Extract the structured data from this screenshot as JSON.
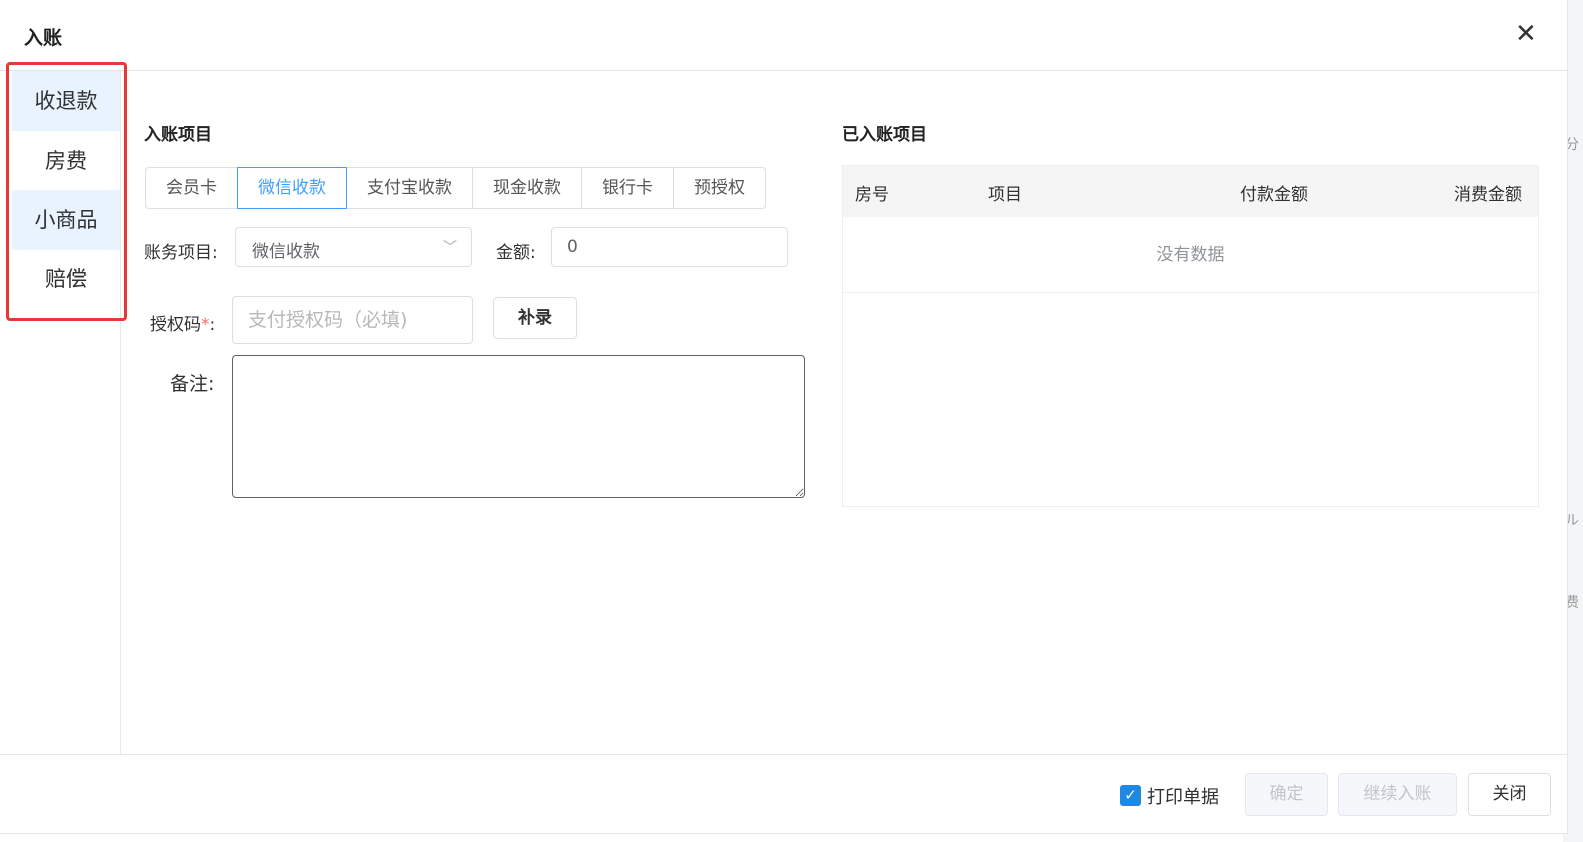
{
  "dialog": {
    "title": "入账",
    "close_icon": "close-icon"
  },
  "sidebar": {
    "items": [
      {
        "label": "收退款"
      },
      {
        "label": "房费"
      },
      {
        "label": "小商品"
      },
      {
        "label": "赔偿"
      }
    ]
  },
  "entry": {
    "section_title": "入账项目",
    "payment_tabs": [
      {
        "label": "会员卡",
        "active": false
      },
      {
        "label": "微信收款",
        "active": true
      },
      {
        "label": "支付宝收款",
        "active": false
      },
      {
        "label": "现金收款",
        "active": false
      },
      {
        "label": "银行卡",
        "active": false
      },
      {
        "label": "预授权",
        "active": false
      }
    ],
    "account_item_label": "账务项目:",
    "account_item_value": "微信收款",
    "amount_label": "金额:",
    "amount_value": "0",
    "auth_label": "授权码",
    "auth_required_mark": "*",
    "auth_colon": ":",
    "auth_placeholder": "支付授权码（必填)",
    "supplement_button": "补录",
    "remark_label": "备注:",
    "remark_value": ""
  },
  "posted": {
    "section_title": "已入账项目",
    "columns": [
      "房号",
      "项目",
      "付款金额",
      "消费金额"
    ],
    "empty_text": "没有数据"
  },
  "footer": {
    "print_receipt_label": "打印单据",
    "print_receipt_checked": true,
    "confirm_button": "确定",
    "continue_button": "继续入账",
    "close_button": "关闭"
  },
  "colors": {
    "accent": "#409eff",
    "highlight_outline": "#e53935",
    "checkbox": "#1e88e5"
  }
}
